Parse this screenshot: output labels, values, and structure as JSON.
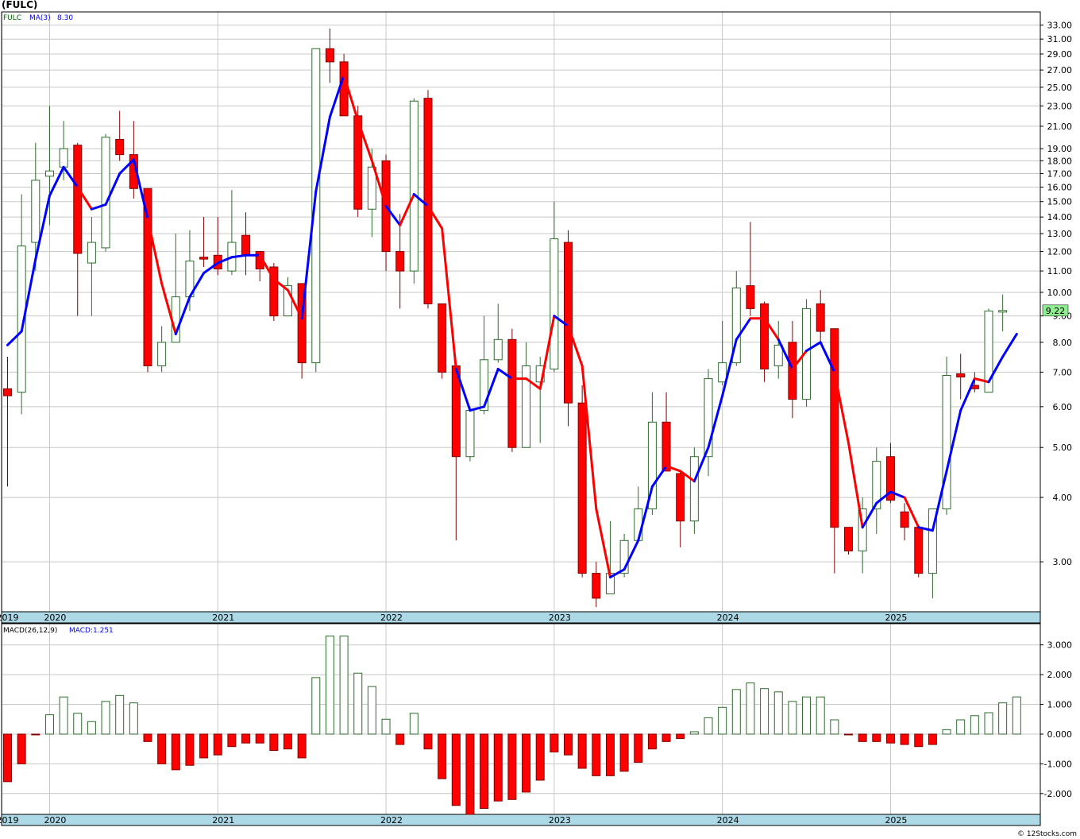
{
  "title": "(FULC)",
  "credit": "© 12Stocks.com",
  "colors": {
    "up_body": "#ffffff",
    "up_stroke": "#2e6b2e",
    "down_body": "#ff0000",
    "down_stroke": "#800000",
    "ma_up": "#0000ff",
    "ma_down": "#ff0000",
    "grid": "#c8c8c8",
    "axis_band": "#add8e6",
    "price_tag": "#90ee90"
  },
  "chart_data": [
    {
      "type": "candlestick",
      "ticker_label": "FULC",
      "ma_label": "MA(3)",
      "ma_value": "8.30",
      "last_price": "9.22",
      "y_scale": "log",
      "ylim": [
        2.4,
        35
      ],
      "y_ticks": [
        "3.00",
        "4.00",
        "5.00",
        "6.00",
        "7.00",
        "8.00",
        "9.00",
        "10.00",
        "11.00",
        "12.00",
        "13.00",
        "14.00",
        "15.00",
        "16.00",
        "17.00",
        "18.00",
        "19.00",
        "21.00",
        "23.00",
        "25.00",
        "27.00",
        "29.00",
        "31.00",
        "33.00"
      ],
      "x_ticks": [
        {
          "label": "2019",
          "index": -0.4
        },
        {
          "label": "2020",
          "index": 3
        },
        {
          "label": "2021",
          "index": 15
        },
        {
          "label": "2022",
          "index": 27
        },
        {
          "label": "2023",
          "index": 39
        },
        {
          "label": "2024",
          "index": 51
        },
        {
          "label": "2025",
          "index": 63
        }
      ],
      "grid": true,
      "candles": [
        {
          "o": 6.5,
          "h": 7.5,
          "l": 4.2,
          "c": 6.3
        },
        {
          "o": 6.4,
          "h": 15.5,
          "l": 5.8,
          "c": 12.3
        },
        {
          "o": 12.5,
          "h": 19.5,
          "l": 11.0,
          "c": 16.5
        },
        {
          "o": 16.8,
          "h": 23.0,
          "l": 13.5,
          "c": 17.2
        },
        {
          "o": 17.5,
          "h": 21.5,
          "l": 16.5,
          "c": 19.0
        },
        {
          "o": 19.3,
          "h": 19.5,
          "l": 9.0,
          "c": 11.9
        },
        {
          "o": 11.4,
          "h": 14.0,
          "l": 9.0,
          "c": 12.5
        },
        {
          "o": 12.2,
          "h": 20.3,
          "l": 12.0,
          "c": 20.0
        },
        {
          "o": 19.8,
          "h": 22.5,
          "l": 18.0,
          "c": 18.5
        },
        {
          "o": 18.5,
          "h": 21.5,
          "l": 15.2,
          "c": 15.9
        },
        {
          "o": 15.9,
          "h": 15.8,
          "l": 7.0,
          "c": 7.2
        },
        {
          "o": 7.2,
          "h": 8.6,
          "l": 7.0,
          "c": 8.0
        },
        {
          "o": 8.0,
          "h": 13.0,
          "l": 8.0,
          "c": 9.8
        },
        {
          "o": 9.8,
          "h": 13.2,
          "l": 9.2,
          "c": 11.5
        },
        {
          "o": 11.7,
          "h": 14.0,
          "l": 11.2,
          "c": 11.6
        },
        {
          "o": 11.8,
          "h": 14.0,
          "l": 10.8,
          "c": 11.1
        },
        {
          "o": 11.0,
          "h": 15.8,
          "l": 10.8,
          "c": 12.5
        },
        {
          "o": 12.9,
          "h": 14.3,
          "l": 10.8,
          "c": 11.8
        },
        {
          "o": 12.0,
          "h": 12.0,
          "l": 10.5,
          "c": 11.1
        },
        {
          "o": 11.2,
          "h": 11.4,
          "l": 8.8,
          "c": 9.0
        },
        {
          "o": 9.0,
          "h": 10.7,
          "l": 9.0,
          "c": 10.3
        },
        {
          "o": 10.4,
          "h": 10.4,
          "l": 6.8,
          "c": 7.3
        },
        {
          "o": 7.3,
          "h": 29.7,
          "l": 7.0,
          "c": 29.7
        },
        {
          "o": 29.7,
          "h": 32.5,
          "l": 25.5,
          "c": 28.0
        },
        {
          "o": 28.0,
          "h": 29.0,
          "l": 22.0,
          "c": 22.0
        },
        {
          "o": 22.0,
          "h": 23.0,
          "l": 14.0,
          "c": 14.5
        },
        {
          "o": 14.5,
          "h": 19.0,
          "l": 12.8,
          "c": 17.5
        },
        {
          "o": 18.0,
          "h": 18.5,
          "l": 11.0,
          "c": 12.0
        },
        {
          "o": 12.0,
          "h": 14.2,
          "l": 9.3,
          "c": 11.0
        },
        {
          "o": 11.0,
          "h": 23.8,
          "l": 10.4,
          "c": 23.5
        },
        {
          "o": 23.8,
          "h": 24.7,
          "l": 9.3,
          "c": 9.5
        },
        {
          "o": 9.5,
          "h": 9.5,
          "l": 6.8,
          "c": 7.0
        },
        {
          "o": 7.2,
          "h": 7.3,
          "l": 3.3,
          "c": 4.8
        },
        {
          "o": 4.8,
          "h": 6.0,
          "l": 4.7,
          "c": 5.9
        },
        {
          "o": 5.9,
          "h": 9.0,
          "l": 5.8,
          "c": 7.4
        },
        {
          "o": 7.4,
          "h": 9.5,
          "l": 7.3,
          "c": 8.1
        },
        {
          "o": 8.1,
          "h": 8.5,
          "l": 4.9,
          "c": 5.0
        },
        {
          "o": 5.0,
          "h": 8.0,
          "l": 5.0,
          "c": 7.2
        },
        {
          "o": 6.7,
          "h": 7.5,
          "l": 5.1,
          "c": 7.2
        },
        {
          "o": 7.1,
          "h": 15.0,
          "l": 7.0,
          "c": 12.7
        },
        {
          "o": 12.5,
          "h": 13.2,
          "l": 5.5,
          "c": 6.1
        },
        {
          "o": 6.1,
          "h": 6.6,
          "l": 2.8,
          "c": 2.85
        },
        {
          "o": 2.85,
          "h": 3.0,
          "l": 2.45,
          "c": 2.55
        },
        {
          "o": 2.6,
          "h": 3.6,
          "l": 2.6,
          "c": 2.85
        },
        {
          "o": 2.85,
          "h": 3.4,
          "l": 2.8,
          "c": 3.3
        },
        {
          "o": 3.3,
          "h": 4.2,
          "l": 3.3,
          "c": 3.8
        },
        {
          "o": 3.8,
          "h": 6.4,
          "l": 3.7,
          "c": 5.6
        },
        {
          "o": 5.6,
          "h": 6.4,
          "l": 4.5,
          "c": 4.5
        },
        {
          "o": 4.45,
          "h": 4.5,
          "l": 3.2,
          "c": 3.6
        },
        {
          "o": 3.6,
          "h": 5.0,
          "l": 3.4,
          "c": 4.8
        },
        {
          "o": 4.8,
          "h": 7.1,
          "l": 4.4,
          "c": 6.8
        },
        {
          "o": 6.7,
          "h": 8.8,
          "l": 6.6,
          "c": 7.3
        },
        {
          "o": 7.3,
          "h": 11.0,
          "l": 7.2,
          "c": 10.2
        },
        {
          "o": 10.3,
          "h": 13.7,
          "l": 9.0,
          "c": 9.3
        },
        {
          "o": 9.5,
          "h": 9.6,
          "l": 6.7,
          "c": 7.1
        },
        {
          "o": 7.2,
          "h": 8.8,
          "l": 6.8,
          "c": 7.9
        },
        {
          "o": 8.0,
          "h": 8.8,
          "l": 5.7,
          "c": 6.2
        },
        {
          "o": 6.2,
          "h": 9.7,
          "l": 6.0,
          "c": 9.3
        },
        {
          "o": 9.5,
          "h": 10.1,
          "l": 8.0,
          "c": 8.4
        },
        {
          "o": 8.5,
          "h": 8.5,
          "l": 2.85,
          "c": 3.5
        },
        {
          "o": 3.5,
          "h": 3.5,
          "l": 3.1,
          "c": 3.15
        },
        {
          "o": 3.15,
          "h": 4.0,
          "l": 2.85,
          "c": 3.8
        },
        {
          "o": 3.8,
          "h": 5.0,
          "l": 3.4,
          "c": 4.7
        },
        {
          "o": 4.8,
          "h": 5.1,
          "l": 3.9,
          "c": 3.95
        },
        {
          "o": 3.75,
          "h": 3.9,
          "l": 3.3,
          "c": 3.5
        },
        {
          "o": 3.5,
          "h": 3.5,
          "l": 2.8,
          "c": 2.85
        },
        {
          "o": 2.85,
          "h": 3.8,
          "l": 2.55,
          "c": 3.8
        },
        {
          "o": 3.8,
          "h": 7.5,
          "l": 3.7,
          "c": 6.9
        },
        {
          "o": 6.95,
          "h": 7.6,
          "l": 6.2,
          "c": 6.85
        },
        {
          "o": 6.6,
          "h": 7.0,
          "l": 6.4,
          "c": 6.5
        },
        {
          "o": 6.4,
          "h": 9.3,
          "l": 6.4,
          "c": 9.2
        },
        {
          "o": 9.2,
          "h": 9.9,
          "l": 8.4,
          "c": 9.22
        }
      ],
      "ma_values": [
        7.9,
        8.4,
        11.6,
        15.4,
        17.5,
        16.0,
        14.5,
        14.8,
        17.0,
        18.1,
        13.9,
        10.4,
        8.3,
        9.8,
        10.9,
        11.4,
        11.7,
        11.8,
        11.8,
        10.6,
        10.1,
        8.9,
        15.7,
        21.9,
        26.4,
        21.5,
        18.0,
        14.7,
        13.5,
        15.5,
        14.7,
        13.3,
        7.1,
        5.9,
        6.0,
        7.1,
        6.8,
        6.8,
        6.5,
        9.0,
        8.6,
        7.2,
        3.8,
        2.8,
        2.9,
        3.3,
        4.2,
        4.6,
        4.5,
        4.3,
        5.0,
        6.3,
        8.1,
        8.9,
        8.9,
        8.1,
        7.1,
        7.7,
        8.0,
        7.0,
        5.1,
        3.5,
        3.9,
        4.1,
        4.0,
        3.5,
        3.45,
        4.5,
        5.9,
        6.8,
        6.7,
        7.5,
        8.3
      ],
      "ma_colors": [
        "blue",
        "blue",
        "blue",
        "blue",
        "blue",
        "red",
        "blue",
        "blue",
        "blue",
        "blue",
        "red",
        "red",
        "blue",
        "blue",
        "blue",
        "blue",
        "blue",
        "blue",
        "red",
        "red",
        "red",
        "blue",
        "blue",
        "blue",
        "red",
        "red",
        "red",
        "blue",
        "red",
        "blue",
        "red",
        "red",
        "blue",
        "blue",
        "blue",
        "blue",
        "red",
        "red",
        "red",
        "blue",
        "red",
        "red",
        "red",
        "blue",
        "blue",
        "blue",
        "blue",
        "red",
        "red",
        "blue",
        "blue",
        "blue",
        "blue",
        "red",
        "red",
        "blue",
        "red",
        "blue",
        "blue",
        "red",
        "red",
        "blue",
        "blue",
        "blue",
        "red",
        "blue",
        "blue",
        "blue",
        "blue",
        "red",
        "blue",
        "blue"
      ]
    },
    {
      "type": "bar",
      "indicator": "MACD(26,12,9)",
      "macd_label": "MACD:1.251",
      "ylim": [
        -2.7,
        3.5
      ],
      "y_ticks": [
        "-2.000",
        "-1.000",
        "0.000",
        "1.000",
        "2.000",
        "3.000"
      ],
      "values": [
        -1.6,
        -1.0,
        -0.02,
        0.65,
        1.25,
        0.7,
        0.42,
        1.1,
        1.3,
        1.05,
        -0.25,
        -1.0,
        -1.2,
        -1.05,
        -0.8,
        -0.7,
        -0.42,
        -0.3,
        -0.3,
        -0.55,
        -0.5,
        -0.8,
        1.9,
        3.3,
        3.3,
        2.05,
        1.6,
        0.5,
        -0.35,
        0.7,
        -0.5,
        -1.5,
        -2.4,
        -2.7,
        -2.5,
        -2.25,
        -2.2,
        -1.95,
        -1.55,
        -0.6,
        -0.7,
        -1.15,
        -1.4,
        -1.4,
        -1.25,
        -0.95,
        -0.5,
        -0.25,
        -0.15,
        0.08,
        0.55,
        0.9,
        1.5,
        1.72,
        1.53,
        1.42,
        1.1,
        1.25,
        1.25,
        0.48,
        -0.02,
        -0.25,
        -0.25,
        -0.3,
        -0.35,
        -0.42,
        -0.35,
        0.15,
        0.48,
        0.62,
        0.72,
        1.05,
        1.251
      ]
    }
  ]
}
